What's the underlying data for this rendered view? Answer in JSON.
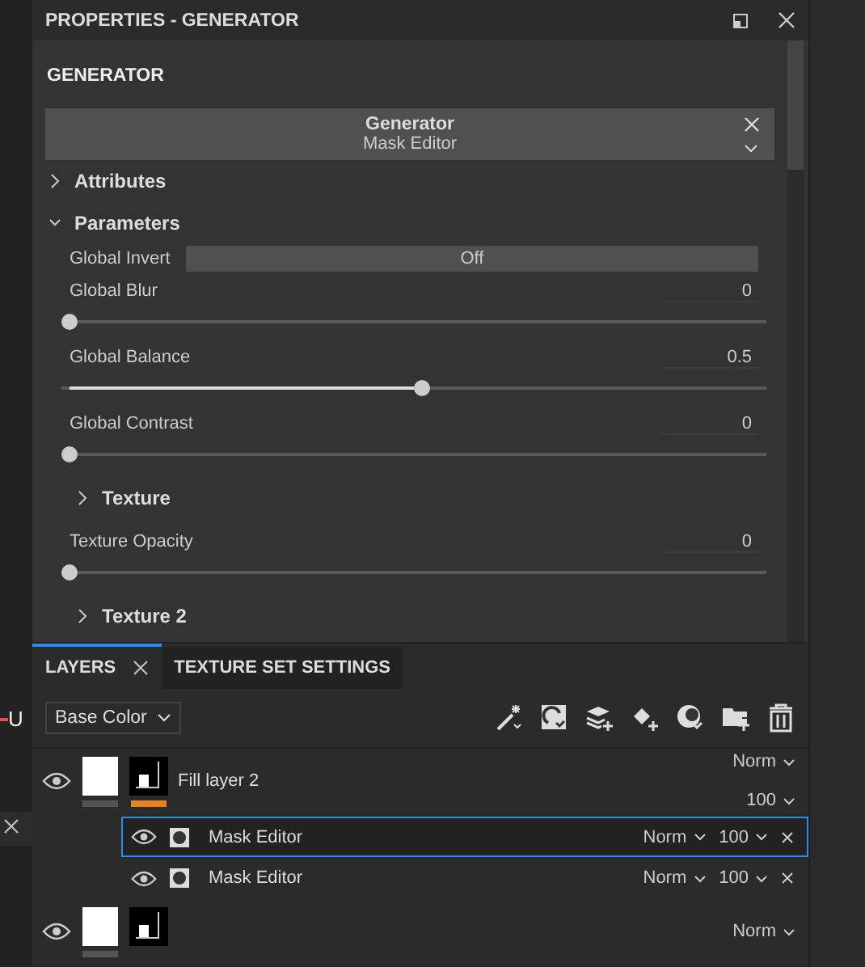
{
  "side_fragment": {
    "text": "U"
  },
  "panel": {
    "title": "PROPERTIES - GENERATOR"
  },
  "generator": {
    "heading": "GENERATOR",
    "name": "Generator",
    "preset": "Mask Editor"
  },
  "sections": [
    {
      "label": "Attributes",
      "expanded": false
    },
    {
      "label": "Parameters",
      "expanded": true,
      "parameters": [
        {
          "kind": "toggle",
          "label": "Global Invert",
          "value": "Off"
        },
        {
          "kind": "slider",
          "label": "Global Blur",
          "value": "0",
          "level": 0
        },
        {
          "kind": "slider",
          "label": "Global Balance",
          "value": "0.5",
          "level": 0.5
        },
        {
          "kind": "slider",
          "label": "Global Contrast",
          "value": "0",
          "level": 0
        },
        {
          "kind": "group",
          "label": "Texture",
          "expanded": false
        },
        {
          "kind": "slider",
          "label": "Texture Opacity",
          "value": "0",
          "level": 0
        },
        {
          "kind": "group",
          "label": "Texture 2",
          "expanded": false
        }
      ]
    }
  ],
  "tabs": [
    {
      "label": "LAYERS",
      "selected": true
    },
    {
      "label": "TEXTURE SET SETTINGS",
      "selected": false
    }
  ],
  "channel": "Base Color",
  "layers": [
    {
      "name": "Fill layer 2",
      "blend": "Norm",
      "opacity": "100",
      "visible": true,
      "children": [
        {
          "name": "Mask Editor",
          "blend": "Norm",
          "opacity": "100",
          "visible": true,
          "selected": true
        },
        {
          "name": "Mask Editor",
          "blend": "Norm",
          "opacity": "100",
          "visible": true,
          "selected": false
        }
      ]
    },
    {
      "blend": "Norm",
      "visible": true
    }
  ]
}
